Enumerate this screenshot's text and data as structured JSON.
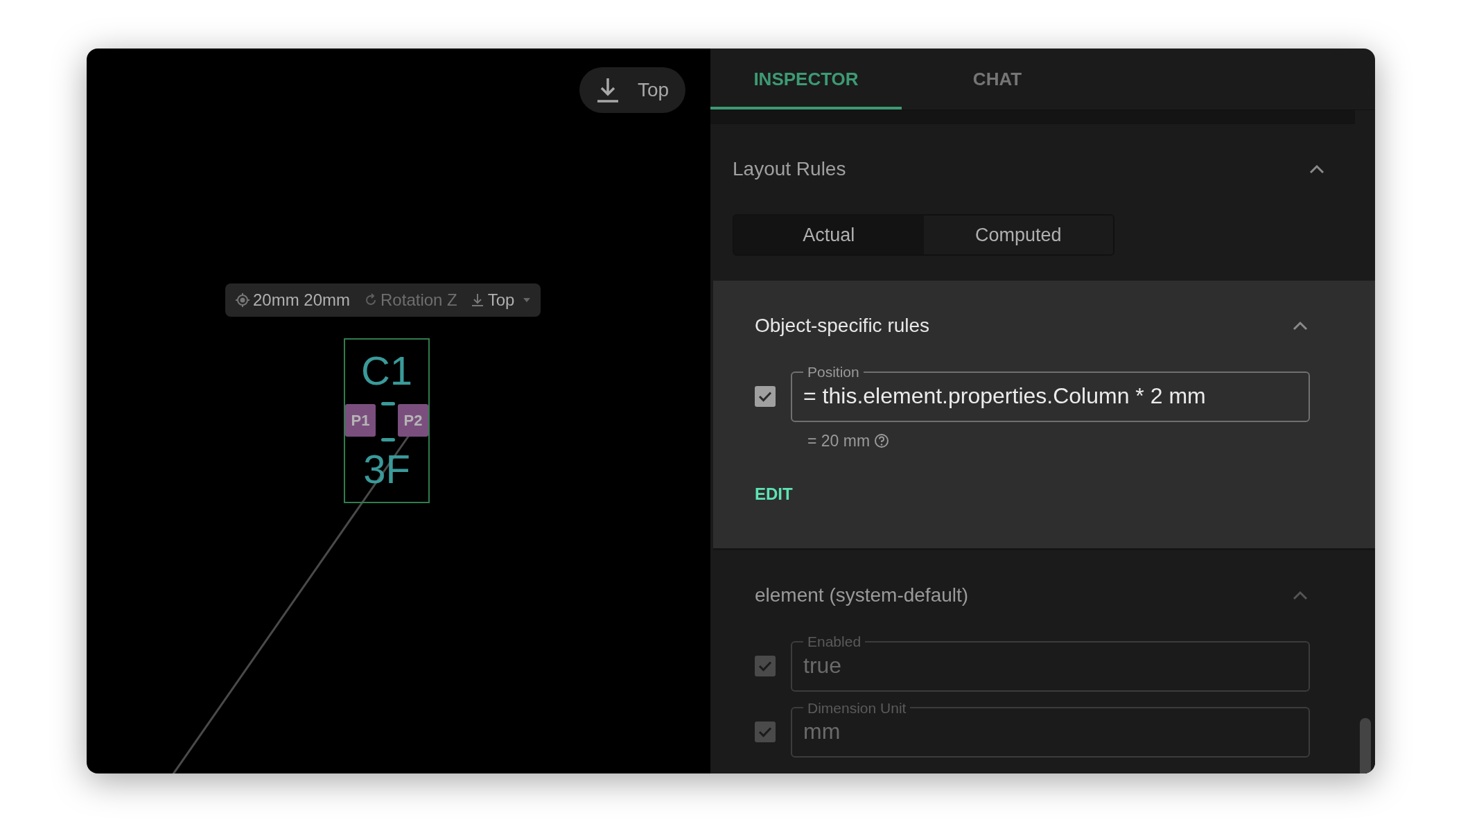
{
  "canvas": {
    "view_button": {
      "label": "Top"
    },
    "toolbar": {
      "position": "20mm 20mm",
      "rotation": "Rotation Z",
      "side": "Top"
    },
    "component": {
      "designator": "C1",
      "value": "3F",
      "pads": [
        "P1",
        "P2"
      ]
    }
  },
  "tabs": [
    {
      "label": "INSPECTOR",
      "selected": true
    },
    {
      "label": "CHAT",
      "selected": false
    }
  ],
  "layout_rules": {
    "title": "Layout Rules",
    "expanded": true,
    "modes": [
      {
        "label": "Actual",
        "selected": true
      },
      {
        "label": "Computed",
        "selected": false
      }
    ],
    "sections": [
      {
        "title": "Object-specific rules",
        "expanded": true,
        "active": true,
        "action": "EDIT",
        "rules": [
          {
            "label": "Position",
            "value": "= this.element.properties.Column * 2 mm",
            "checked": true,
            "result": "= 20 mm"
          }
        ]
      },
      {
        "title": "element (system-default)",
        "expanded": true,
        "active": false,
        "rules": [
          {
            "label": "Enabled",
            "value": "true",
            "checked": true
          },
          {
            "label": "Dimension Unit",
            "value": "mm",
            "checked": true
          }
        ]
      }
    ]
  }
}
